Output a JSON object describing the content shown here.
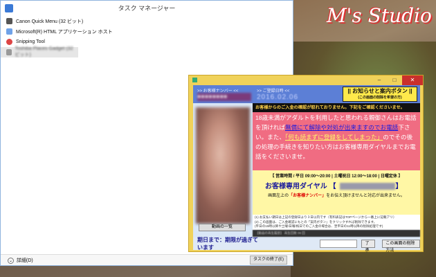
{
  "desktop": {
    "logo_text": "M's Studio"
  },
  "task_manager": {
    "title": "タスク マネージャー",
    "processes": [
      {
        "name": "Canon Quick Menu (32 ビット)",
        "icon": "canon-icon",
        "blurred": false
      },
      {
        "name": "Microsoft(R) HTML アプリケーション ホスト",
        "icon": "html-app-icon",
        "blurred": false
      },
      {
        "name": "Snipping Tool",
        "icon": "scissors-icon",
        "blurred": false
      },
      {
        "name": "Toshiba Places Gadget (32 ビット)",
        "icon": "gadget-icon",
        "blurred": true
      }
    ],
    "details_label": "詳細(D)",
    "end_task_label": "タスクの終了(E)"
  },
  "popup": {
    "window_buttons": {
      "minimize": "–",
      "maximize": "□",
      "close": "✕"
    },
    "customer_number_label": ">> お客様ナンバー <<",
    "customer_number_value": "●●●●●●●●",
    "registration_date_label": ">> ご登録日時 <<",
    "registration_date_value": "2016.02.06",
    "notice_button": {
      "title": "|| お知らせと案内ボタン ||",
      "subtitle": "(この画面の削除を希望の方)"
    },
    "video_list_button": "動画の一覧",
    "alert_text": "お客様からのご入金の確認が取れておりません。下記をご確認くださいませ。",
    "message": {
      "part1": "18歳未満がアダルトを利用したと思われる親御さんはお電話を頂ければ",
      "link1": "無償にて解除や対処が出来ますのでお電話",
      "part2": "下さい。また、",
      "link2": "「何も読まずに登録をしてしまった」",
      "part3": "のでその後の処理の手続きを知りたい方はお客様専用ダイヤルまでお電話をくださいませ。"
    },
    "hours": "【 営業時間 / 平日 09:00～20:00 | 土曜祝日 12:00～18:00 | 日曜定休 】",
    "dial_label": "お客様専用ダイヤル",
    "dial_bracket_open": "【",
    "dial_bracket_close": "】",
    "notice_line_before": "画面左上の",
    "notice_line_red": "「お客様ナンバー」",
    "notice_line_after": "をお伝え頂けませんと対応が出来ません。",
    "fine_print": [
      "(1) お支払い期日は上記の登録日より３日以内です（有料表記はTOPページから一番上に記載アリ）",
      "(2) この画面は、ご入金確認にもとの「案内ボタン」をクリックすれば削除できます。",
      "(平日の15時以降や土曜/日曜/祝日でのご入金の場合は、翌平日の11時以降の削除処理です)"
    ],
    "dark_strip_text": "【動画の再生履歴】 再生回数 09 回",
    "deadline_text": "期日まで：期限が過ぎています",
    "confirm_button": "了承",
    "delete_button": "この画面の削除方法"
  }
}
